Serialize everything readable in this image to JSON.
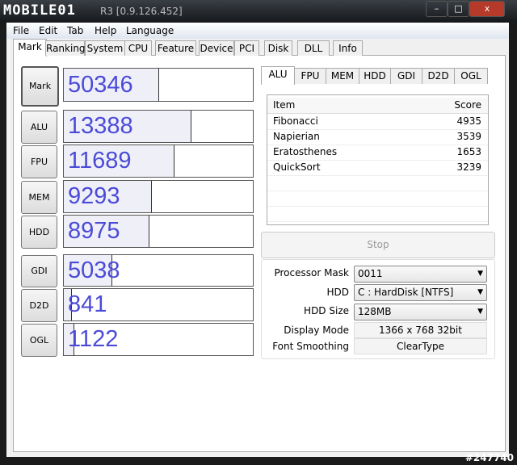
{
  "window": {
    "title": "R3 [0.9.126.452]",
    "watermark_logo": "MOBILE01",
    "badge": "#247740"
  },
  "menu": [
    "File",
    "Edit",
    "Tab",
    "Help",
    "Language"
  ],
  "tabs": [
    "Mark",
    "Ranking",
    "System",
    "CPU",
    "Feature",
    "Device",
    "PCI",
    "Disk",
    "DLL",
    "Info"
  ],
  "active_tab": "Mark",
  "marks": [
    {
      "label": "Mark",
      "score": "50346",
      "fraction": 0.5
    },
    {
      "label": "ALU",
      "score": "13388",
      "fraction": 0.67
    },
    {
      "label": "FPU",
      "score": "11689",
      "fraction": 0.58
    },
    {
      "label": "MEM",
      "score": "9293",
      "fraction": 0.46
    },
    {
      "label": "HDD",
      "score": "8975",
      "fraction": 0.45
    },
    {
      "label": "GDI",
      "score": "5038",
      "fraction": 0.25
    },
    {
      "label": "D2D",
      "score": "841",
      "fraction": 0.04
    },
    {
      "label": "OGL",
      "score": "1122",
      "fraction": 0.05
    }
  ],
  "subtabs": [
    "ALU",
    "FPU",
    "MEM",
    "HDD",
    "GDI",
    "D2D",
    "OGL"
  ],
  "list": {
    "headers": [
      "Item",
      "Score"
    ],
    "rows": [
      [
        "Fibonacci",
        "4935"
      ],
      [
        "Napierian",
        "3539"
      ],
      [
        "Eratosthenes",
        "1653"
      ],
      [
        "QuickSort",
        "3239"
      ]
    ]
  },
  "stop_label": "Stop",
  "settings": {
    "processor_mask": {
      "label": "Processor Mask",
      "value": "0011"
    },
    "hdd": {
      "label": "HDD",
      "value": "C : HardDisk [NTFS]"
    },
    "hdd_size": {
      "label": "HDD Size",
      "value": "128MB"
    },
    "display_mode": {
      "label": "Display Mode",
      "value": "1366 x 768 32bit"
    },
    "font_smoothing": {
      "label": "Font Smoothing",
      "value": "ClearType"
    }
  },
  "colors": {
    "score": "#4b4bd8"
  }
}
